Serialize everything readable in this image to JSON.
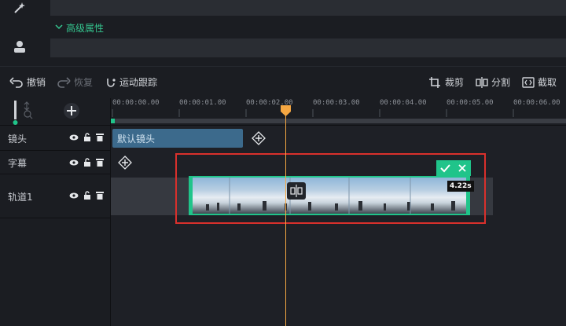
{
  "top_panel": {
    "advanced_label": "高级属性"
  },
  "toolbar": {
    "undo": "撤销",
    "redo": "恢复",
    "motion_tracking": "运动跟踪",
    "crop": "裁剪",
    "split": "分割",
    "trim": "截取"
  },
  "ruler": {
    "ticks": [
      "00:00:00.00",
      "00:00:01.00",
      "00:00:02.00",
      "00:00:03.00",
      "00:00:04.00",
      "00:00:05.00",
      "00:00:06.00"
    ]
  },
  "tracks": {
    "shot": "镜头",
    "subtitle": "字幕",
    "track1": "轨道1"
  },
  "clips": {
    "shot_default": "默认镜头",
    "duration": "4.22s"
  },
  "colors": {
    "accent_green": "#20c48a",
    "playhead": "#f5a742",
    "highlight_red": "#d9302c"
  }
}
